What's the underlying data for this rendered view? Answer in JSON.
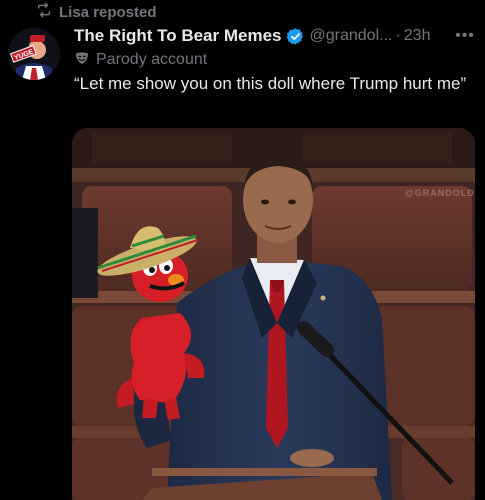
{
  "repost": {
    "label": "Lisa reposted",
    "icon": "repost-icon"
  },
  "tweet": {
    "avatar_badge": "YUGE",
    "display_name": "The Right To Bear Memes",
    "verified": true,
    "handle": "@grandol...",
    "separator": "·",
    "time": "23h",
    "more_icon": "more-icon",
    "parody_label": "Parody account",
    "text": "“Let me show you on this doll where Trump hurt me”"
  },
  "media": {
    "watermark": "@GRANDOLDMEMES",
    "alt_description_icon": "photo"
  },
  "colors": {
    "background": "#000000",
    "text_primary": "#e7e9ea",
    "text_secondary": "#71767b",
    "verified_blue": "#1d9bf0"
  }
}
